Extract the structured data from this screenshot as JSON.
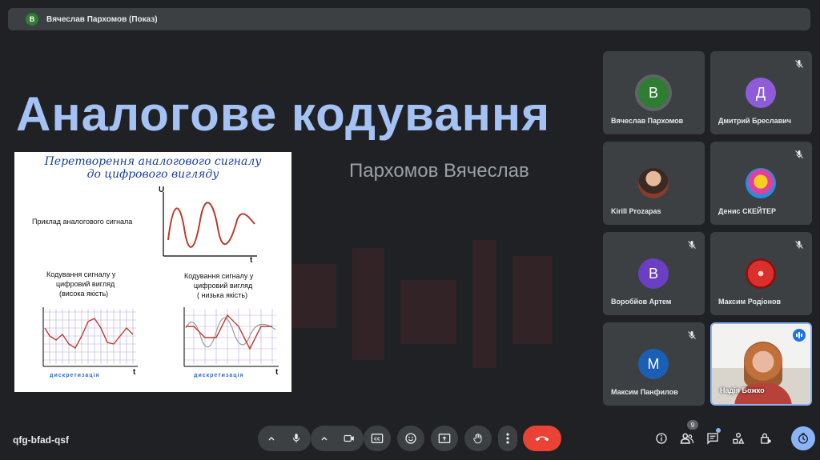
{
  "top": {
    "avatar_letter": "В",
    "title": "Вячеслав Пархомов (Показ)"
  },
  "slide": {
    "title": "Аналогове кодування",
    "author": "Пархомов Вячеслав",
    "image": {
      "heading_line1": "Перетворення аналогового сигналу",
      "heading_line2": "до цифрового вигляду",
      "example_label": "Приклад аналогового сигнала",
      "axis_u": "U",
      "axis_t": "t",
      "high_label_1": "Кодування сигналу у",
      "high_label_2": "цифровий вигляд",
      "high_label_3": "(висока якість)",
      "low_label_1": "Кодування сигналу у",
      "low_label_2": "цифровий вигляд",
      "low_label_3": "( низька якість)",
      "disc_label": "дискретизація"
    }
  },
  "participants": [
    {
      "name": "Вячеслав Пархомов",
      "letter": "В",
      "color": "#2e7d32",
      "muted": false,
      "ring": true
    },
    {
      "name": "Дмитрий Бреславич",
      "letter": "Д",
      "color": "#8e5cd9",
      "muted": true
    },
    {
      "name": "Kirill Prozapas",
      "letter": "",
      "color": "#7a5a4a",
      "muted": false,
      "photo": true
    },
    {
      "name": "Денис СКЕЙТЕР",
      "letter": "",
      "color": "#e040a0",
      "muted": true,
      "photo": true
    },
    {
      "name": "Воробйов Артем",
      "letter": "В",
      "color": "#6a3fc4",
      "muted": true
    },
    {
      "name": "Максим Родіонов",
      "letter": "",
      "color": "#d9302b",
      "muted": true,
      "photo": true
    },
    {
      "name": "Максим Панфилов",
      "letter": "М",
      "color": "#1a5fb4",
      "muted": true
    },
    {
      "name": "Надія Божко",
      "letter": "",
      "color": "#c85",
      "muted": false,
      "speaking": true
    }
  ],
  "meeting": {
    "code": "qfg-bfad-qsf",
    "people_count": "9"
  },
  "icons": [
    "mic-icon",
    "camera-icon",
    "captions-icon",
    "emoji-icon",
    "present-icon",
    "hand-icon",
    "more-icon",
    "end-call-icon",
    "info-icon",
    "people-icon",
    "chat-icon",
    "activities-icon",
    "host-controls-icon",
    "timer-icon"
  ]
}
